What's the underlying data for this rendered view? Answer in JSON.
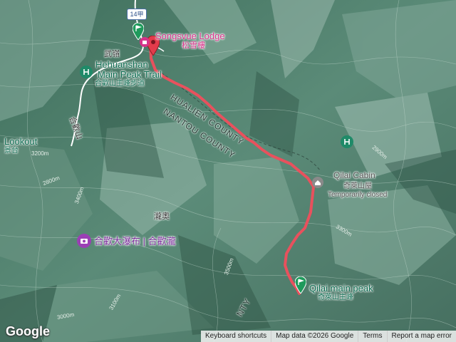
{
  "map": {
    "highway_shield": "14甲",
    "places": {
      "wuling": "武嶺",
      "lunghe": "瀧奧",
      "hehuan_road": "合歡山"
    },
    "counties": {
      "hualien": "HUALIEN COUNTY",
      "nantou": "NANTOU COUNTY",
      "nantou_short": "NTY"
    },
    "pois": {
      "songsvue": {
        "name": "Songsvue Lodge",
        "sub": "松雪樓"
      },
      "hehuan_trail": {
        "name_line1": "Hehuanshan",
        "name_line2": "Main Peak Trail",
        "sub": "合歡山主峰步道"
      },
      "lookout": {
        "name": "Lookout",
        "sub": "景台"
      },
      "qilai_cabin": {
        "name": "Qilai Cabin",
        "sub": "奇萊山屋",
        "status": "Temporarily closed"
      },
      "waterfall": {
        "name": "合歡大瀑布 | 合歡瀧"
      },
      "qilai_peak": {
        "name": "Qilai main peak",
        "sub": "奇萊山主峰"
      }
    },
    "contours": [
      "2800m",
      "2900m",
      "3000m",
      "3100m",
      "3200m",
      "3300m",
      "3400m",
      "3500m"
    ],
    "route_color": "#e8515d"
  },
  "footer": {
    "logo": "Google",
    "keyboard": "Keyboard shortcuts",
    "map_data": "Map data ©2026 Google",
    "terms": "Terms",
    "report": "Report a map error"
  }
}
